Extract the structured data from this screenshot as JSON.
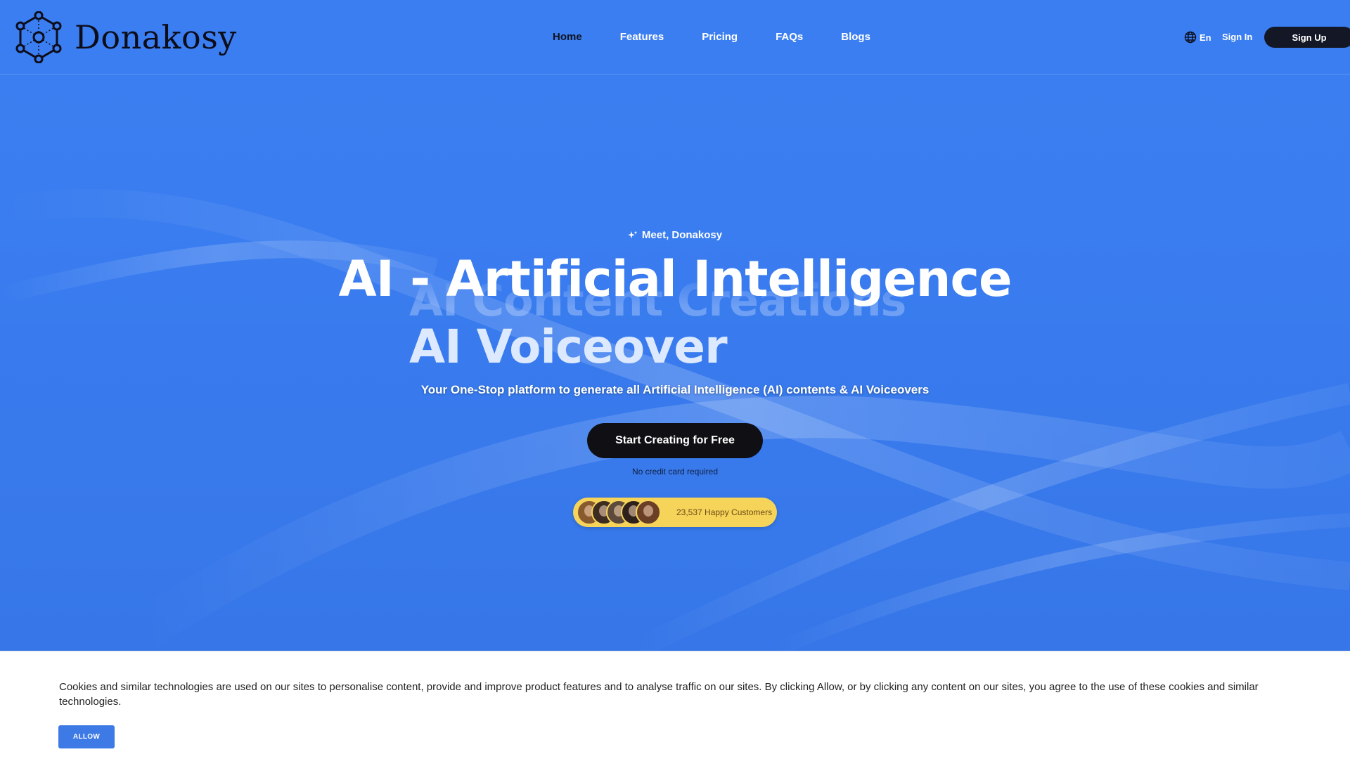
{
  "brand": {
    "name": "Donakosy"
  },
  "nav": {
    "items": [
      {
        "label": "Home",
        "active": true
      },
      {
        "label": "Features"
      },
      {
        "label": "Pricing"
      },
      {
        "label": "FAQs"
      },
      {
        "label": "Blogs"
      }
    ]
  },
  "header": {
    "language": "En",
    "sign_in": "Sign In",
    "sign_up": "Sign Up"
  },
  "hero": {
    "eyebrow": "Meet, Donakosy",
    "headline": "AI - Artificial Intelligence",
    "rotating_prev": "AI Content Creations",
    "rotating_current": "AI Voiceover",
    "subtitle": "Your One-Stop platform to generate all Artificial Intelligence (AI) contents & AI Voiceovers",
    "cta": "Start Creating for Free",
    "cta_note": "No credit card required",
    "customers": "23,537 Happy Customers"
  },
  "cookie": {
    "text": "Cookies and similar technologies are used on our sites to personalise content, provide and improve product features and to analyse traffic on our sites. By clicking Allow, or by clicking any content on our sites, you agree to the use of these cookies and similar technologies.",
    "allow": "ALLOW"
  },
  "colors": {
    "hero_bg": "#3a7df0",
    "dark_button": "#141826",
    "customers_badge": "#f6d45a",
    "allow_button": "#3d7ae6"
  },
  "icons": [
    "logo-network-icon",
    "globe-icon",
    "sparkle-icon"
  ]
}
